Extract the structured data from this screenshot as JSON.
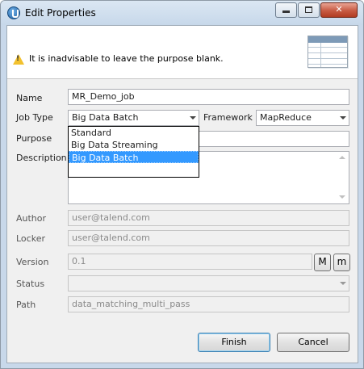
{
  "window": {
    "title": "Edit Properties"
  },
  "header": {
    "warning": "It is inadvisable to leave the purpose blank."
  },
  "labels": {
    "name": "Name",
    "job_type": "Job Type",
    "framework": "Framework",
    "purpose": "Purpose",
    "description": "Description",
    "author": "Author",
    "locker": "Locker",
    "version": "Version",
    "status": "Status",
    "path": "Path"
  },
  "fields": {
    "name": "MR_Demo_job",
    "job_type": "Big Data Batch",
    "framework": "MapReduce",
    "purpose": "",
    "description": "",
    "author": "user@talend.com",
    "locker": "user@talend.com",
    "version": "0.1",
    "status": "",
    "path": "data_matching_multi_pass"
  },
  "job_type_options": [
    "Standard",
    "Big Data Streaming",
    "Big Data Batch"
  ],
  "version_buttons": {
    "major": "M",
    "minor": "m"
  },
  "buttons": {
    "finish": "Finish",
    "cancel": "Cancel"
  },
  "colors": {
    "selection": "#3399ff",
    "warning": "#f2c12e"
  },
  "icons": {
    "app": "talend-icon",
    "warning": "warning-icon",
    "header": "table-icon"
  }
}
